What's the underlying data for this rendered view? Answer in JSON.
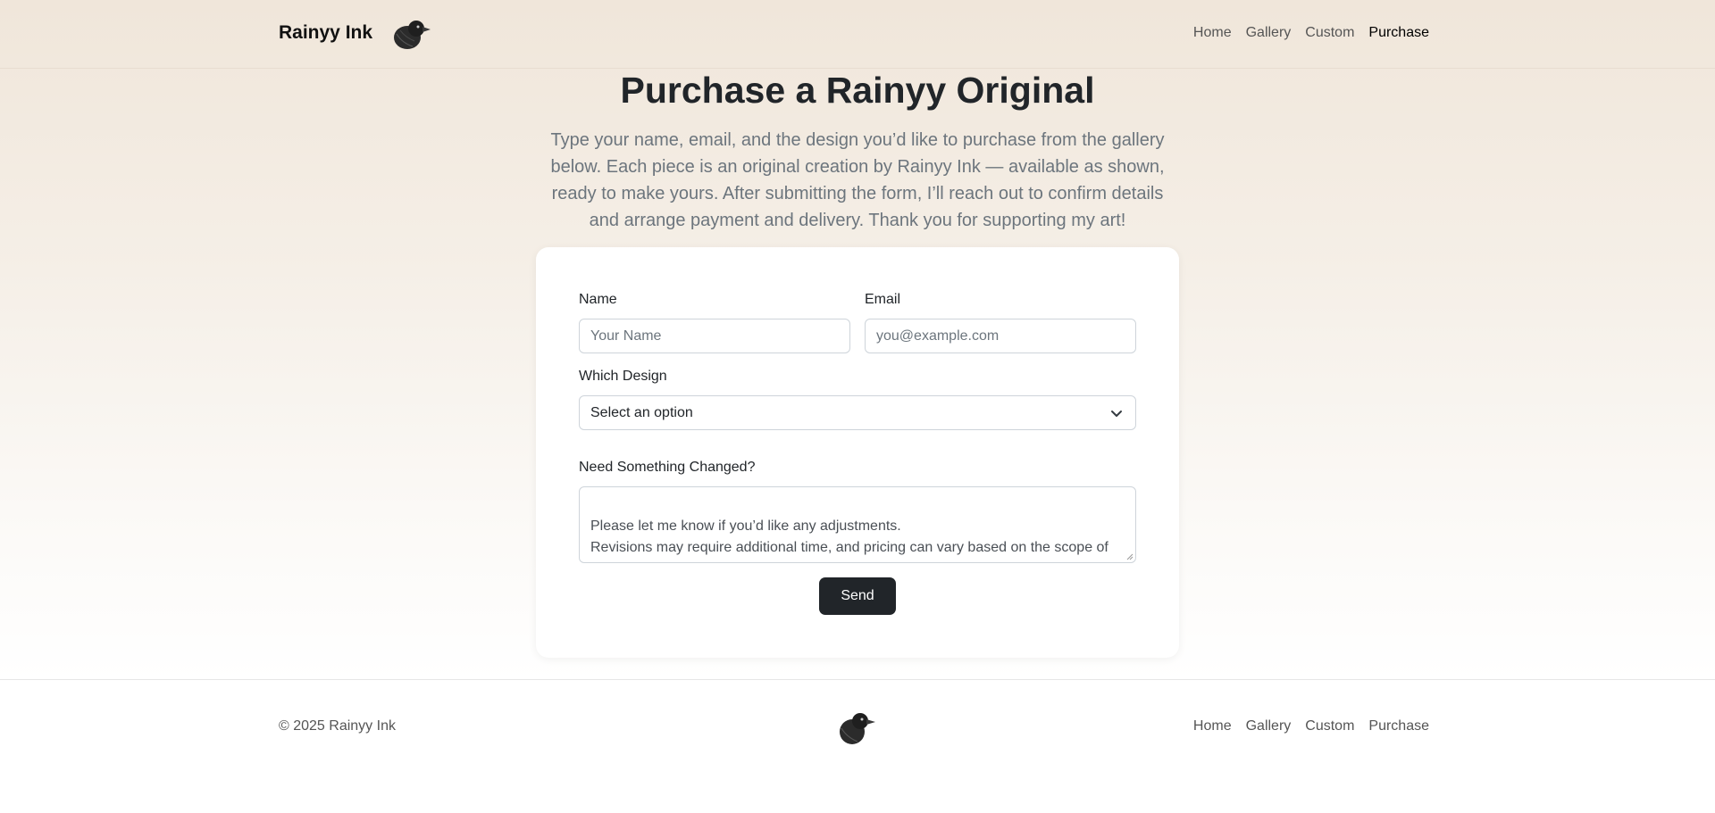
{
  "navbar": {
    "brand": "Rainyy Ink",
    "logo_icon": "crow-icon",
    "links": [
      "Home",
      "Gallery",
      "Custom",
      "Purchase"
    ],
    "active": "Purchase"
  },
  "header": {
    "title": "Purchase a Rainyy Original",
    "lead": "Type your name, email, and the design you’d like to purchase from the gallery below. Each piece is an original creation by Rainyy Ink — available as shown, ready to make yours. After submitting the form, I’ll reach out to confirm details and arrange payment and delivery. Thank you for supporting my art!"
  },
  "form": {
    "name_label": "Name",
    "name_placeholder": "Your Name",
    "email_label": "Email",
    "email_placeholder": "you@example.com",
    "design_label": "Which Design",
    "design_selected": "Select an option",
    "changes_label": "Need Something Changed?",
    "changes_placeholder": "Please let me know if you’d like any adjustments.\nRevisions may require additional time, and pricing can vary based on the scope of changes.",
    "send_label": "Send"
  },
  "footer": {
    "copyright": "© 2025 Rainyy Ink",
    "logo_icon": "crow-icon",
    "links": [
      "Home",
      "Gallery",
      "Custom",
      "Purchase"
    ]
  },
  "colors": {
    "hero_top": "#f0e6da",
    "button": "#212529",
    "text_muted": "#6c757d"
  }
}
